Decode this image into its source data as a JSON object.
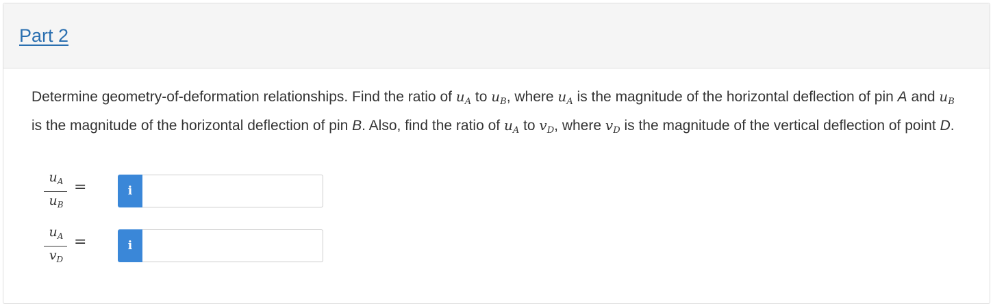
{
  "header": {
    "part_title": "Part 2"
  },
  "question": {
    "t1": "Determine geometry-of-deformation relationships. Find the ratio of ",
    "t2": " to ",
    "t3": ", where ",
    "t4": " is the magnitude of the horizontal deflection of pin ",
    "pinA": "A",
    "t5": " and ",
    "t6": " is the magnitude of the horizontal deflection of pin ",
    "pinB": "B",
    "t7": ". Also, find the ratio of ",
    "t8": " to ",
    "t9": ", where ",
    "t10": " is the magnitude of the vertical deflection of point ",
    "pointD": "D",
    "t11": ".",
    "sym_u": "u",
    "sym_v": "v",
    "sub_A": "A",
    "sub_B": "B",
    "sub_D": "D"
  },
  "answers": [
    {
      "num_base": "u",
      "num_sub": "A",
      "den_base": "u",
      "den_sub": "B",
      "equals": "=",
      "info_icon": "i",
      "value": ""
    },
    {
      "num_base": "u",
      "num_sub": "A",
      "den_base": "v",
      "den_sub": "D",
      "equals": "=",
      "info_icon": "i",
      "value": ""
    }
  ],
  "colors": {
    "link": "#2a6fb0",
    "info_button": "#3a87d8",
    "header_bg": "#f5f5f5"
  }
}
